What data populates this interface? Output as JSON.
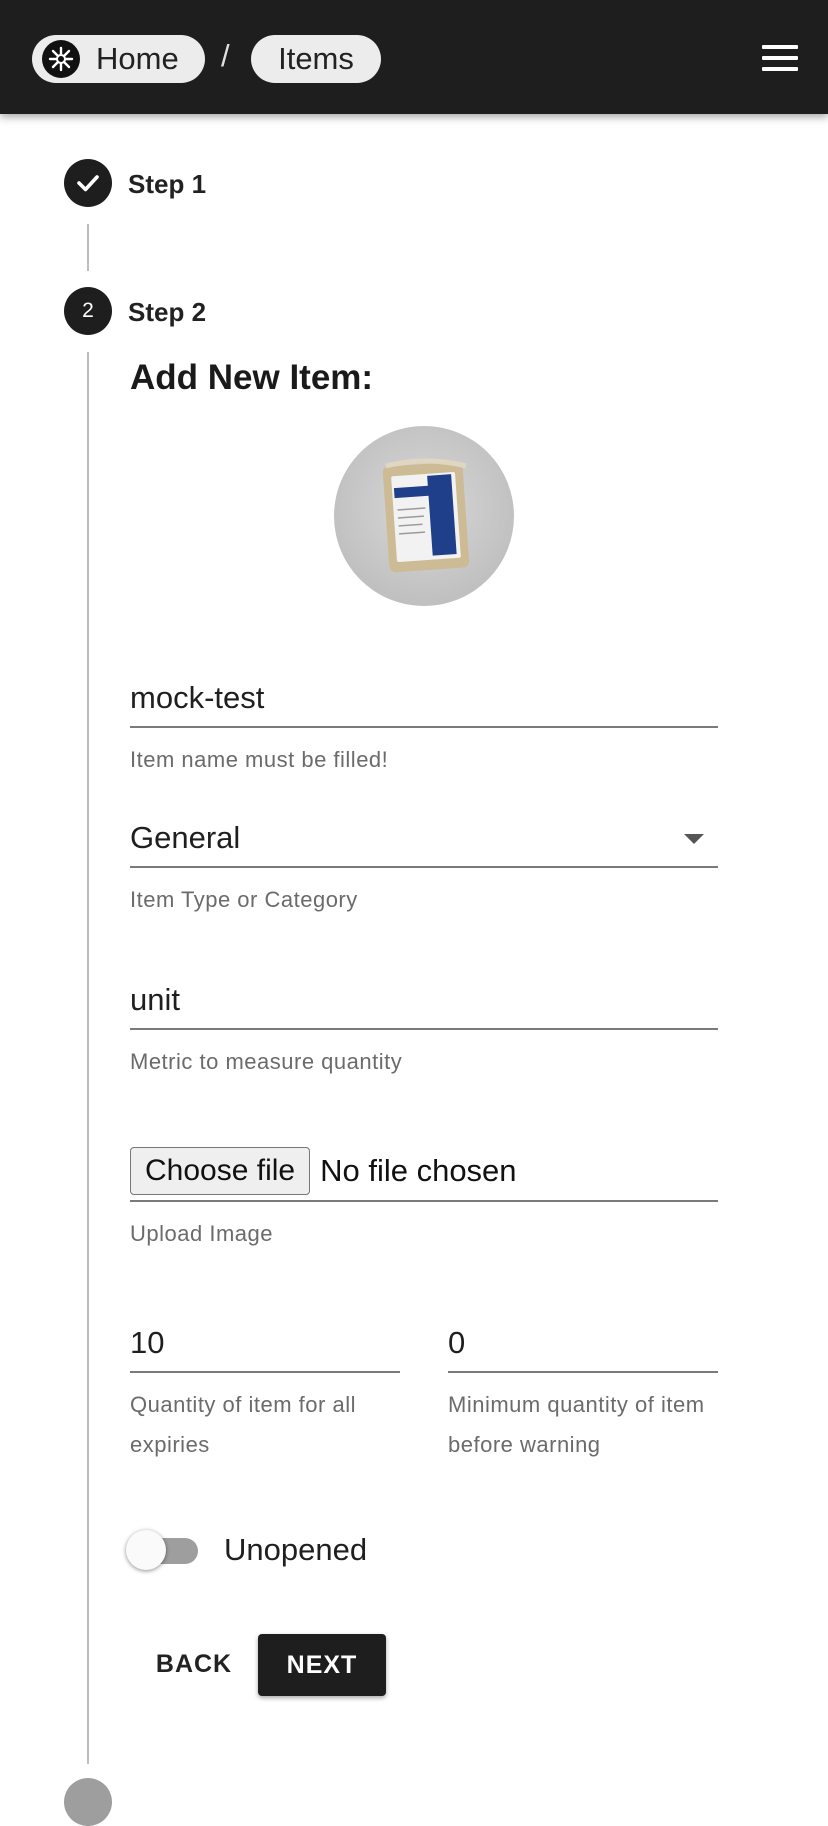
{
  "header": {
    "breadcrumb": {
      "home_label": "Home",
      "separator": "/",
      "items_label": "Items"
    },
    "menu_icon": "hamburger-menu-icon"
  },
  "stepper": {
    "step1": {
      "label": "Step 1",
      "status": "completed",
      "icon": "check-icon"
    },
    "step2": {
      "label": "Step 2",
      "number": "2",
      "status": "active"
    }
  },
  "form": {
    "title": "Add New Item:",
    "item_image": "item-photo",
    "name": {
      "value": "mock-test",
      "helper": "Item name must be filled!"
    },
    "category": {
      "value": "General",
      "helper": "Item Type or Category"
    },
    "metric": {
      "value": "unit",
      "helper": "Metric to measure quantity"
    },
    "upload": {
      "button_label": "Choose file",
      "status": "No file chosen",
      "helper": "Upload Image"
    },
    "quantity": {
      "value": "10",
      "helper": "Quantity of item for all expiries"
    },
    "min_quantity": {
      "value": "0",
      "helper": "Minimum quantity of item before warning"
    },
    "opened_toggle": {
      "label": "Unopened",
      "checked": false
    },
    "back_label": "BACK",
    "next_label": "NEXT"
  },
  "colors": {
    "appbar": "#1e1e1e",
    "accent": "#1e1e1e",
    "helper_text": "#6b6b6b"
  }
}
